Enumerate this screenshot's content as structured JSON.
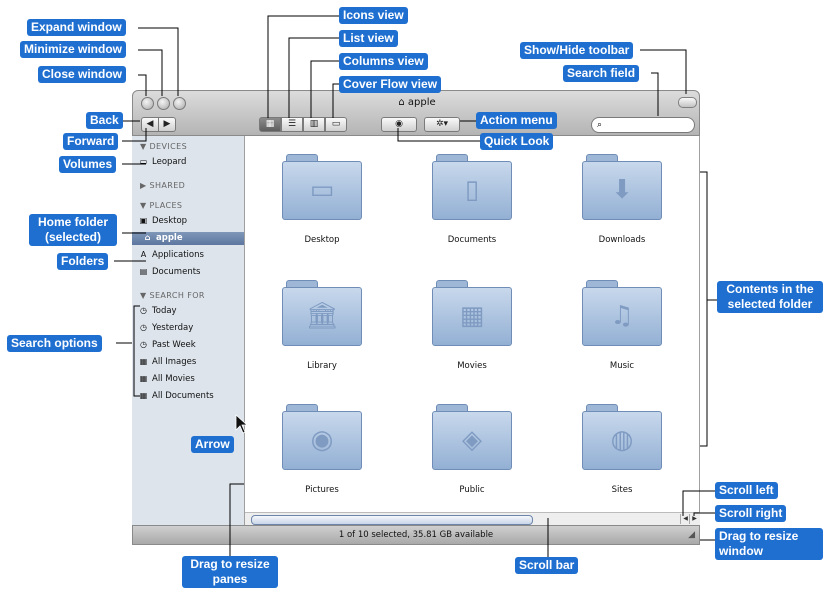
{
  "window": {
    "title": "apple",
    "status_text": "1 of 10 selected, 35.81 GB available",
    "view_buttons": [
      {
        "name": "icons-view-button",
        "glyph": "▦",
        "selected": true
      },
      {
        "name": "list-view-button",
        "glyph": "☰",
        "selected": false
      },
      {
        "name": "columns-view-button",
        "glyph": "▥",
        "selected": false
      },
      {
        "name": "cover-flow-view-button",
        "glyph": "▭",
        "selected": false
      }
    ],
    "nav_glyphs": {
      "back": "◀",
      "forward": "▶"
    },
    "quick_look_glyph": "◉",
    "action_glyph": "✲▾",
    "search_placeholder": "",
    "scroll_glyphs": {
      "left": "◀",
      "right": "▶"
    }
  },
  "sidebar": {
    "sections": [
      {
        "title": "DEVICES",
        "items": [
          {
            "label": "Leopard",
            "icon": "drive-icon",
            "glyph": "▭"
          }
        ]
      },
      {
        "title": "SHARED",
        "items": []
      },
      {
        "title": "PLACES",
        "items": [
          {
            "label": "Desktop",
            "icon": "desktop-icon",
            "glyph": "▣"
          },
          {
            "label": "apple",
            "icon": "home-icon",
            "glyph": "⌂",
            "selected": true
          },
          {
            "label": "Applications",
            "icon": "applications-icon",
            "glyph": "A"
          },
          {
            "label": "Documents",
            "icon": "documents-icon",
            "glyph": "▤"
          }
        ]
      },
      {
        "title": "SEARCH FOR",
        "items": [
          {
            "label": "Today",
            "icon": "clock-icon",
            "glyph": "◷"
          },
          {
            "label": "Yesterday",
            "icon": "clock-icon",
            "glyph": "◷"
          },
          {
            "label": "Past Week",
            "icon": "clock-icon",
            "glyph": "◷"
          },
          {
            "label": "All Images",
            "icon": "smart-folder-icon",
            "glyph": "▦"
          },
          {
            "label": "All Movies",
            "icon": "smart-folder-icon",
            "glyph": "▦"
          },
          {
            "label": "All Documents",
            "icon": "smart-folder-icon",
            "glyph": "▦"
          }
        ]
      }
    ]
  },
  "folders": [
    {
      "label": "Desktop",
      "emblem": "▭"
    },
    {
      "label": "Documents",
      "emblem": "▯"
    },
    {
      "label": "Downloads",
      "emblem": "⬇"
    },
    {
      "label": "Library",
      "emblem": "🏛"
    },
    {
      "label": "Movies",
      "emblem": "▦"
    },
    {
      "label": "Music",
      "emblem": "♫"
    },
    {
      "label": "Pictures",
      "emblem": "◉"
    },
    {
      "label": "Public",
      "emblem": "◈"
    },
    {
      "label": "Sites",
      "emblem": "◍"
    }
  ],
  "annotations": {
    "expand_window": "Expand window",
    "minimize_window": "Minimize window",
    "close_window": "Close window",
    "back": "Back",
    "forward": "Forward",
    "volumes": "Volumes",
    "home_folder": "Home folder (selected)",
    "folders": "Folders",
    "search_options": "Search options",
    "arrow": "Arrow",
    "icons_view": "Icons view",
    "list_view": "List view",
    "columns_view": "Columns view",
    "cover_flow_view": "Cover Flow view",
    "action_menu": "Action menu",
    "quick_look": "Quick Look",
    "show_hide_toolbar": "Show/Hide toolbar",
    "search_field": "Search field",
    "contents": "Contents in the selected folder",
    "scroll_left": "Scroll left",
    "scroll_right": "Scroll right",
    "drag_to_resize_window": "Drag to resize window",
    "scroll_bar": "Scroll bar",
    "drag_to_resize_panes": "Drag to resize panes"
  },
  "colors": {
    "callout": "#1f6fd1",
    "selection": "#5c76a0",
    "folder": "#a9c0de"
  }
}
